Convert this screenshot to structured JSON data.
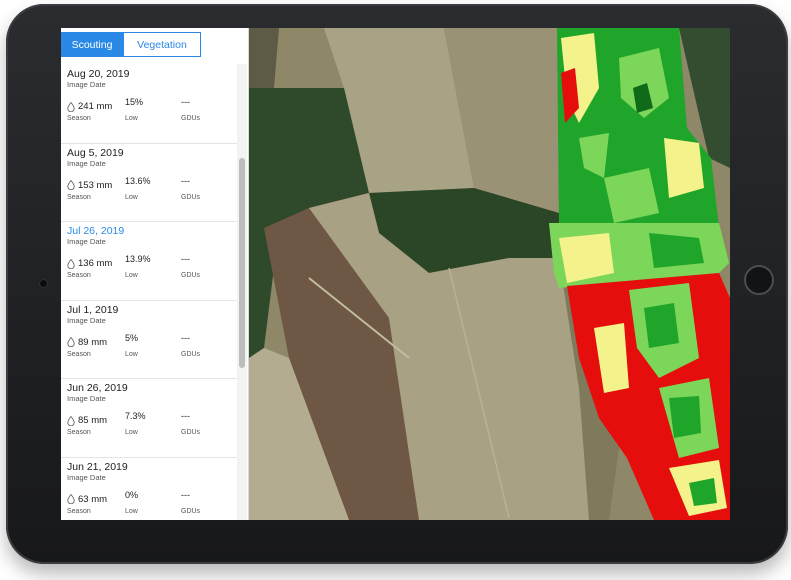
{
  "tabs": [
    {
      "label": "Scouting",
      "active": true
    },
    {
      "label": "Vegetation",
      "active": false
    }
  ],
  "image_date_label": "Image Date",
  "season_label": "Season",
  "low_label": "Low",
  "gdus_label": "GDUs",
  "items": [
    {
      "date": "Aug 20, 2019",
      "rain": "241 mm",
      "pct": "15%",
      "gdu": "---",
      "selected": false
    },
    {
      "date": "Aug 5, 2019",
      "rain": "153 mm",
      "pct": "13.6%",
      "gdu": "---",
      "selected": false
    },
    {
      "date": "Jul 26, 2019",
      "rain": "136 mm",
      "pct": "13.9%",
      "gdu": "---",
      "selected": true
    },
    {
      "date": "Jul 1, 2019",
      "rain": "89 mm",
      "pct": "5%",
      "gdu": "---",
      "selected": false
    },
    {
      "date": "Jun 26, 2019",
      "rain": "85 mm",
      "pct": "7.3%",
      "gdu": "---",
      "selected": false
    },
    {
      "date": "Jun 21, 2019",
      "rain": "63 mm",
      "pct": "0%",
      "gdu": "---",
      "selected": false
    }
  ],
  "colors": {
    "accent": "#2a88e6",
    "ndvi_high": "#1fa52a",
    "ndvi_mid": "#7bd65a",
    "ndvi_low": "#f4f28a",
    "ndvi_stress": "#e60d0d",
    "forest": "#2e4a2a",
    "field_tan": "#9c9270"
  }
}
